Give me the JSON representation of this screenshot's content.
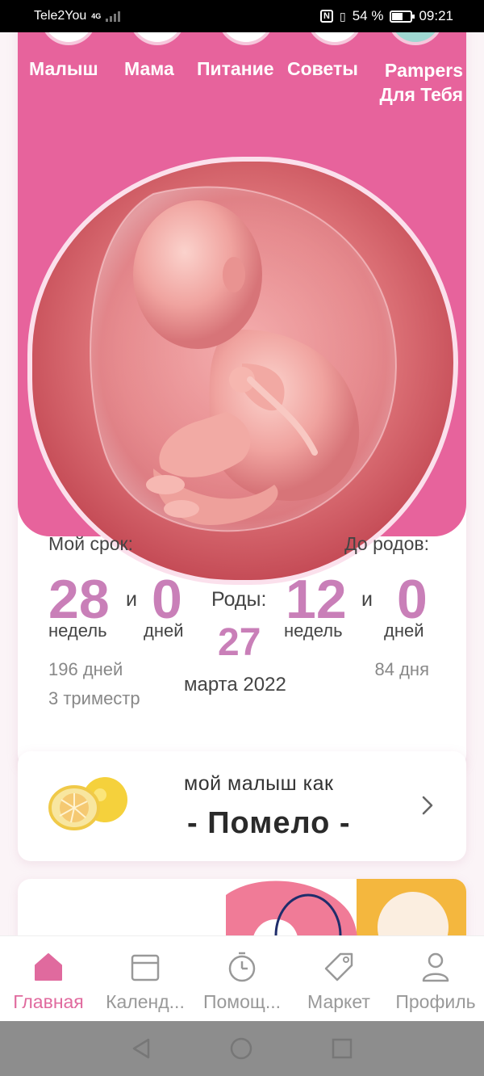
{
  "status": {
    "carrier": "Tele2You",
    "network": "4G",
    "battery": "54 %",
    "time": "09:21"
  },
  "top_tabs": [
    {
      "label": "Малыш"
    },
    {
      "label": "Мама"
    },
    {
      "label": "Питание"
    },
    {
      "label": "Советы"
    },
    {
      "label_line1": "Pampers",
      "label_line2": "Для Тебя"
    }
  ],
  "stats": {
    "my_term_label": "Мой срок:",
    "to_birth_label": "До родов:",
    "weeks_done": "28",
    "and_1": "и",
    "days_done": "0",
    "weeks_unit_1": "недель",
    "days_unit_1": "дней",
    "birth_label": "Роды:",
    "birth_day": "27",
    "birth_month_year": "марта 2022",
    "weeks_left": "12",
    "and_2": "и",
    "days_left": "0",
    "weeks_unit_2": "недель",
    "days_unit_2": "дней",
    "total_days": "196 дней",
    "trimester": "3 триместр",
    "days_remaining": "84 дня"
  },
  "fruit": {
    "subtitle": "мой малыш как",
    "name": "- Помело -"
  },
  "bottom_nav": [
    {
      "label": "Главная",
      "icon": "home-icon",
      "active": true
    },
    {
      "label": "Календ...",
      "icon": "calendar-icon",
      "active": false
    },
    {
      "label": "Помощ...",
      "icon": "timer-icon",
      "active": false
    },
    {
      "label": "Маркет",
      "icon": "tag-icon",
      "active": false
    },
    {
      "label": "Профиль",
      "icon": "profile-icon",
      "active": false
    }
  ],
  "colors": {
    "brand_pink": "#e7639c",
    "accent_purple": "#c97fb8",
    "nav_active": "#e06a9e"
  }
}
